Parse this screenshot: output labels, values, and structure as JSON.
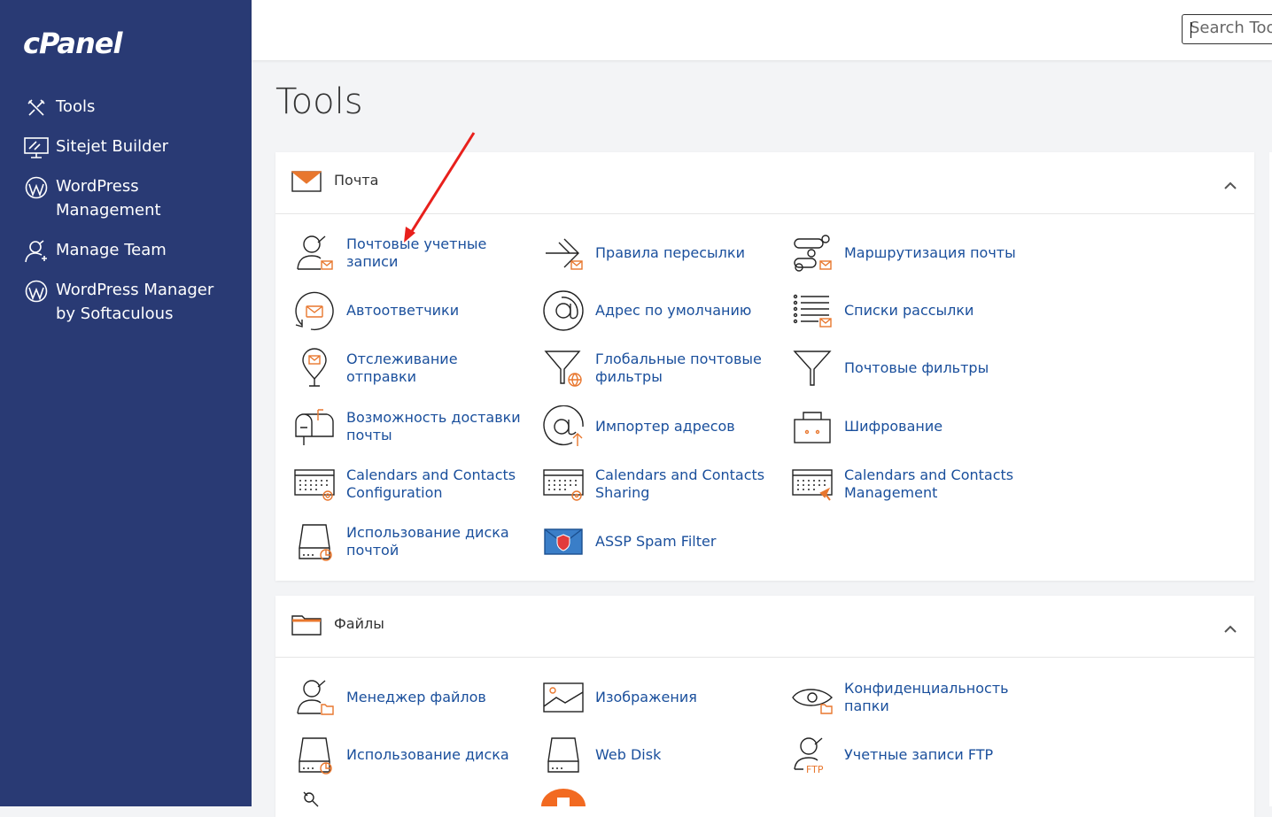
{
  "brand": "cPanel",
  "search": {
    "placeholder": "Search Tools"
  },
  "sidebar": {
    "items": [
      {
        "label": "Tools"
      },
      {
        "label": "Sitejet Builder"
      },
      {
        "label": "WordPress Management"
      },
      {
        "label": "Manage Team"
      },
      {
        "label": "WordPress Manager by Softaculous"
      }
    ]
  },
  "page": {
    "title": "Tools"
  },
  "sections": [
    {
      "title": "Почта",
      "tools": [
        {
          "label": "Почтовые учетные записи",
          "icon": "email-accounts-icon"
        },
        {
          "label": "Правила пересылки",
          "icon": "forwarders-icon"
        },
        {
          "label": "Маршрутизация почты",
          "icon": "email-routing-icon"
        },
        {
          "label": "Автоответчики",
          "icon": "autoresponders-icon"
        },
        {
          "label": "Адрес по умолчанию",
          "icon": "default-address-icon"
        },
        {
          "label": "Списки рассылки",
          "icon": "mailing-lists-icon"
        },
        {
          "label": "Отслеживание отправки",
          "icon": "track-delivery-icon"
        },
        {
          "label": "Глобальные почтовые фильтры",
          "icon": "global-filters-icon"
        },
        {
          "label": "Почтовые фильтры",
          "icon": "email-filters-icon"
        },
        {
          "label": "Возможность доставки почты",
          "icon": "deliverability-icon"
        },
        {
          "label": "Импортер адресов",
          "icon": "address-importer-icon"
        },
        {
          "label": "Шифрование",
          "icon": "encryption-icon"
        },
        {
          "label": "Calendars and Contacts Configuration",
          "icon": "calendar-config-icon"
        },
        {
          "label": "Calendars and Contacts Sharing",
          "icon": "calendar-sharing-icon"
        },
        {
          "label": "Calendars and Contacts Management",
          "icon": "calendar-management-icon"
        },
        {
          "label": "Использование диска почтой",
          "icon": "email-disk-usage-icon"
        },
        {
          "label": "ASSP Spam Filter",
          "icon": "assp-spam-filter-icon"
        }
      ]
    },
    {
      "title": "Файлы",
      "tools": [
        {
          "label": "Менеджер файлов",
          "icon": "file-manager-icon"
        },
        {
          "label": "Изображения",
          "icon": "images-icon"
        },
        {
          "label": "Конфиденциальность папки",
          "icon": "directory-privacy-icon"
        },
        {
          "label": "Использование диска",
          "icon": "disk-usage-icon"
        },
        {
          "label": "Web Disk",
          "icon": "web-disk-icon"
        },
        {
          "label": "Учетные записи FTP",
          "icon": "ftp-accounts-icon"
        }
      ]
    }
  ],
  "colors": {
    "sidebar": "#293a74",
    "link": "#1a4f9c",
    "accent": "#e8772e",
    "annotation": "#e8201c"
  }
}
